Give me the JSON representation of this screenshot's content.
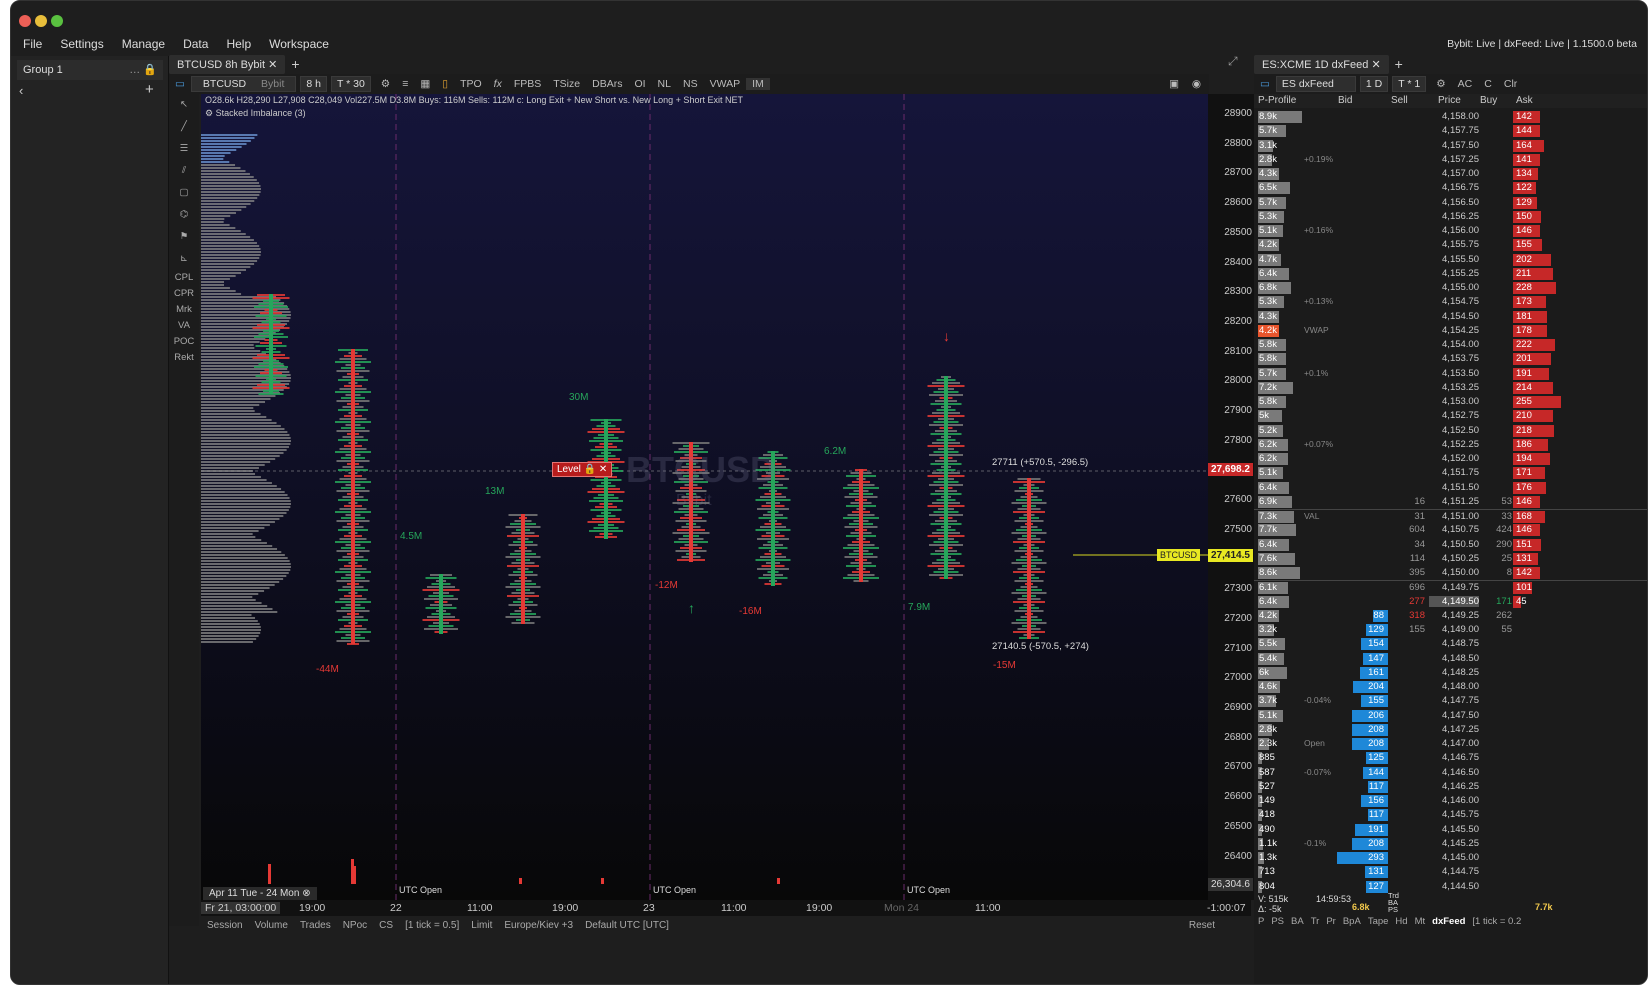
{
  "menu": [
    "File",
    "Settings",
    "Manage",
    "Data",
    "Help",
    "Workspace"
  ],
  "status": "Bybit: Live | dxFeed: Live | 1.1500.0 beta",
  "sidebar": {
    "group": "Group 1"
  },
  "tabs": {
    "left": "BTCUSD 8h Bybit",
    "right": "ES:XCME 1D dxFeed"
  },
  "toolbar": {
    "symbol": "BTCUSD",
    "exchange": "Bybit",
    "interval": "8 h",
    "ticks": "T * 30",
    "items": [
      "TPO",
      "FPBS",
      "TSize",
      "DBArs",
      "OI",
      "NL",
      "NS",
      "VWAP",
      "IM"
    ]
  },
  "right_toolbar": {
    "symbol": "ES dxFeed",
    "interval": "1 D",
    "ticks": "T * 1",
    "items": [
      "AC",
      "C",
      "Clr"
    ]
  },
  "left_tools": [
    "CPL",
    "CPR",
    "Mrk",
    "VA",
    "POC",
    "Rekt"
  ],
  "chart": {
    "info": "O28.6k H28,290 L27,908 C28,049 Vol227.5M D3.8M Buys: 116M Sells: 112M c: Long Exit + New Short vs. New Long + Short Exit NET",
    "stacked": "Stacked Imbalance (3)",
    "watermark": "BTCUSD",
    "watermark_sub": "Bybit",
    "level_label": "Level",
    "current_price": "27,698.2",
    "line_label": "BTCUSD",
    "line_price": "27,414.5",
    "bottom_price": "26,304.6",
    "annotations": {
      "hi": "27711 (+570.5, -296.5)",
      "lo": "27140.5 (-570.5, +274)"
    },
    "deltas": [
      "30M",
      "13M",
      "4.5M",
      "6.2M",
      "-12M",
      "-16M",
      "7.9M",
      "-44M",
      "-15M"
    ],
    "utc_labels": [
      "UTC Open",
      "UTC Open",
      "UTC Open"
    ],
    "date_range": "Apr 11 Tue - 24 Mon",
    "price_axis": [
      "28900",
      "28800",
      "28700",
      "28600",
      "28500",
      "28400",
      "28300",
      "28200",
      "28100",
      "28000",
      "27900",
      "27800",
      "27700",
      "27600",
      "27500",
      "27400",
      "27300",
      "27200",
      "27100",
      "27000",
      "26900",
      "26800",
      "26700",
      "26600",
      "26500",
      "26400"
    ],
    "time_axis": [
      "Fr 21, 03:00:00",
      "19:00",
      "22",
      "11:00",
      "19:00",
      "23",
      "11:00",
      "19:00",
      "Mon 24",
      "11:00"
    ],
    "countdown": "-1:00:07"
  },
  "bottombar": [
    "Session",
    "Volume",
    "Trades",
    "NPoc",
    "CS",
    "[1 tick = 0.5]",
    "Limit",
    "Europe/Kiev +3",
    "Default UTC [UTC]",
    "Reset"
  ],
  "dom": {
    "headers": [
      "P-Profile",
      "Bid",
      "Sell",
      "Price",
      "Buy",
      "Ask"
    ],
    "rows": [
      [
        "8.9k",
        "",
        "",
        "4,158.00",
        "",
        "142"
      ],
      [
        "5.7k",
        "",
        "",
        "4,157.75",
        "",
        "144"
      ],
      [
        "3.1k",
        "",
        "",
        "4,157.50",
        "",
        "164"
      ],
      [
        "2.8k",
        "",
        "",
        "4,157.25",
        "",
        "141"
      ],
      [
        "4.3k",
        "",
        "",
        "4,157.00",
        "",
        "134"
      ],
      [
        "6.5k",
        "",
        "",
        "4,156.75",
        "",
        "122"
      ],
      [
        "5.7k",
        "",
        "",
        "4,156.50",
        "",
        "129"
      ],
      [
        "5.3k",
        "",
        "",
        "4,156.25",
        "",
        "150"
      ],
      [
        "5.1k",
        "",
        "",
        "4,156.00",
        "",
        "146"
      ],
      [
        "4.2k",
        "",
        "",
        "4,155.75",
        "",
        "155"
      ],
      [
        "4.7k",
        "",
        "",
        "4,155.50",
        "",
        "202"
      ],
      [
        "6.4k",
        "",
        "",
        "4,155.25",
        "",
        "211"
      ],
      [
        "6.8k",
        "",
        "",
        "4,155.00",
        "",
        "228"
      ],
      [
        "5.3k",
        "",
        "",
        "4,154.75",
        "",
        "173"
      ],
      [
        "4.3k",
        "",
        "",
        "4,154.50",
        "",
        "181"
      ],
      [
        "4.2k",
        "",
        "",
        "4,154.25",
        "",
        "178"
      ],
      [
        "5.8k",
        "",
        "",
        "4,154.00",
        "",
        "222"
      ],
      [
        "5.8k",
        "",
        "",
        "4,153.75",
        "",
        "201"
      ],
      [
        "5.7k",
        "",
        "",
        "4,153.50",
        "",
        "191"
      ],
      [
        "7.2k",
        "",
        "",
        "4,153.25",
        "",
        "214"
      ],
      [
        "5.8k",
        "",
        "",
        "4,153.00",
        "",
        "255"
      ],
      [
        "5k",
        "",
        "",
        "4,152.75",
        "",
        "210"
      ],
      [
        "5.2k",
        "",
        "",
        "4,152.50",
        "",
        "218"
      ],
      [
        "6.2k",
        "",
        "",
        "4,152.25",
        "",
        "186"
      ],
      [
        "6.2k",
        "",
        "",
        "4,152.00",
        "",
        "194"
      ],
      [
        "5.1k",
        "",
        "",
        "4,151.75",
        "",
        "171"
      ],
      [
        "6.4k",
        "",
        "",
        "4,151.50",
        "",
        "176"
      ],
      [
        "6.9k",
        "",
        "16",
        "4,151.25",
        "53",
        "146"
      ],
      [
        "7.3k",
        "",
        "31",
        "4,151.00",
        "33",
        "168"
      ],
      [
        "7.7k",
        "",
        "604",
        "4,150.75",
        "424",
        "146"
      ],
      [
        "6.4k",
        "",
        "34",
        "4,150.50",
        "290",
        "151"
      ],
      [
        "7.6k",
        "",
        "114",
        "4,150.25",
        "25",
        "131"
      ],
      [
        "8.6k",
        "",
        "395",
        "4,150.00",
        "8",
        "142"
      ],
      [
        "6.1k",
        "",
        "696",
        "4,149.75",
        "",
        "101"
      ],
      [
        "6.4k",
        "",
        "277",
        "4,149.50",
        "171",
        "45"
      ],
      [
        "4.2k",
        "88",
        "318",
        "4,149.25",
        "262",
        ""
      ],
      [
        "3.2k",
        "129",
        "155",
        "4,149.00",
        "55",
        ""
      ],
      [
        "5.5k",
        "154",
        "",
        "4,148.75",
        "",
        ""
      ],
      [
        "5.4k",
        "147",
        "",
        "4,148.50",
        "",
        ""
      ],
      [
        "6k",
        "161",
        "",
        "4,148.25",
        "",
        ""
      ],
      [
        "4.6k",
        "204",
        "",
        "4,148.00",
        "",
        ""
      ],
      [
        "3.7k",
        "155",
        "",
        "4,147.75",
        "",
        ""
      ],
      [
        "5.1k",
        "206",
        "",
        "4,147.50",
        "",
        ""
      ],
      [
        "2.8k",
        "208",
        "",
        "4,147.25",
        "",
        ""
      ],
      [
        "2.3k",
        "208",
        "",
        "4,147.00",
        "",
        ""
      ],
      [
        "885",
        "125",
        "",
        "4,146.75",
        "",
        ""
      ],
      [
        "587",
        "144",
        "",
        "4,146.50",
        "",
        ""
      ],
      [
        "527",
        "117",
        "",
        "4,146.25",
        "",
        ""
      ],
      [
        "149",
        "156",
        "",
        "4,146.00",
        "",
        ""
      ],
      [
        "418",
        "117",
        "",
        "4,145.75",
        "",
        ""
      ],
      [
        "490",
        "191",
        "",
        "4,145.50",
        "",
        ""
      ],
      [
        "1.1k",
        "208",
        "",
        "4,145.25",
        "",
        ""
      ],
      [
        "1.3k",
        "293",
        "",
        "4,145.00",
        "",
        ""
      ],
      [
        "713",
        "131",
        "",
        "4,144.75",
        "",
        ""
      ],
      [
        "804",
        "127",
        "",
        "4,144.50",
        "",
        ""
      ]
    ],
    "notes": {
      "3": "+0.19%",
      "8": "+0.16%",
      "13": "+0.13%",
      "15": "VWAP",
      "18": "+0.1%",
      "23": "+0.07%",
      "28": "VAL",
      "41": "-0.04%",
      "44": "Open",
      "46": "-0.07%",
      "51": "-0.1%"
    },
    "footer": {
      "v": "V: 515k",
      "d": "Δ: -5k",
      "time": "14:59:53",
      "bid_total": "6.8k",
      "ask_total": "7.7k",
      "labels": [
        "Trd",
        "BA",
        "PS"
      ]
    },
    "bottom_tabs": [
      "P",
      "PS",
      "BA",
      "Tr",
      "Pr",
      "BpA",
      "Tape",
      "Hd",
      "Mt"
    ],
    "brand": "dxFeed",
    "tick": "[1 tick = 0.2"
  }
}
